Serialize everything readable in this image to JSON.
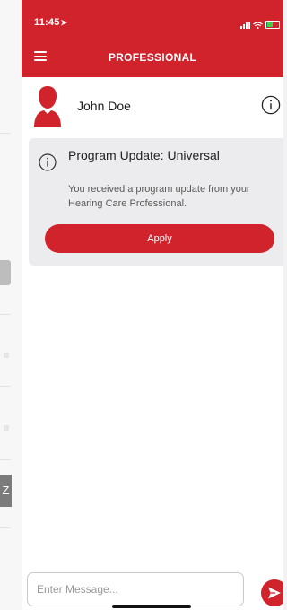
{
  "status_bar": {
    "time": "11:45",
    "location_arrow": "➤"
  },
  "nav": {
    "title": "PROFESSIONAL",
    "menu_icon": "hamburger-menu-icon"
  },
  "contact": {
    "name": "John Doe",
    "avatar_icon": "person-silhouette-icon",
    "info_icon": "info-circle-icon"
  },
  "update_card": {
    "title": "Program Update: Universal",
    "body": "You received a program update from your Hearing Care Professional.",
    "apply_label": "Apply",
    "icon": "info-circle-icon"
  },
  "composer": {
    "placeholder": "Enter Message...",
    "send_icon": "send-arrow-icon"
  },
  "side_peek": {
    "letter": "Z"
  },
  "colors": {
    "brand_red": "#d0232c",
    "card_bg": "#ececee",
    "text_dark": "#1a1a1a",
    "text_muted": "#5a5a5a"
  }
}
